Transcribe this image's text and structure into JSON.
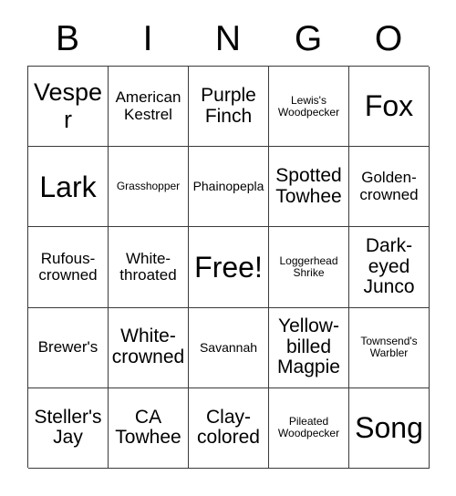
{
  "card": {
    "header_letters": [
      "B",
      "I",
      "N",
      "G",
      "O"
    ],
    "rows": [
      [
        {
          "label": "Vesper",
          "size": "lg"
        },
        {
          "label": "American Kestrel",
          "size": "sm"
        },
        {
          "label": "Purple Finch",
          "size": "md"
        },
        {
          "label": "Lewis's Woodpecker",
          "size": "xxs"
        },
        {
          "label": "Fox",
          "size": "xl"
        }
      ],
      [
        {
          "label": "Lark",
          "size": "xl"
        },
        {
          "label": "Grasshopper",
          "size": "xxs"
        },
        {
          "label": "Phainopepla",
          "size": "xs"
        },
        {
          "label": "Spotted Towhee",
          "size": "md"
        },
        {
          "label": "Golden-crowned",
          "size": "sm"
        }
      ],
      [
        {
          "label": "Rufous-crowned",
          "size": "sm"
        },
        {
          "label": "White-throated",
          "size": "sm"
        },
        {
          "label": "Free!",
          "size": "xl"
        },
        {
          "label": "Loggerhead Shrike",
          "size": "xxs"
        },
        {
          "label": "Dark-eyed Junco",
          "size": "md"
        }
      ],
      [
        {
          "label": "Brewer's",
          "size": "sm"
        },
        {
          "label": "White-crowned",
          "size": "md"
        },
        {
          "label": "Savannah",
          "size": "xs"
        },
        {
          "label": "Yellow-billed Magpie",
          "size": "md"
        },
        {
          "label": "Townsend's Warbler",
          "size": "xxs"
        }
      ],
      [
        {
          "label": "Steller's Jay",
          "size": "md"
        },
        {
          "label": "CA Towhee",
          "size": "md"
        },
        {
          "label": "Clay-colored",
          "size": "md"
        },
        {
          "label": "Pileated Woodpecker",
          "size": "xxs"
        },
        {
          "label": "Song",
          "size": "xl"
        }
      ]
    ]
  }
}
